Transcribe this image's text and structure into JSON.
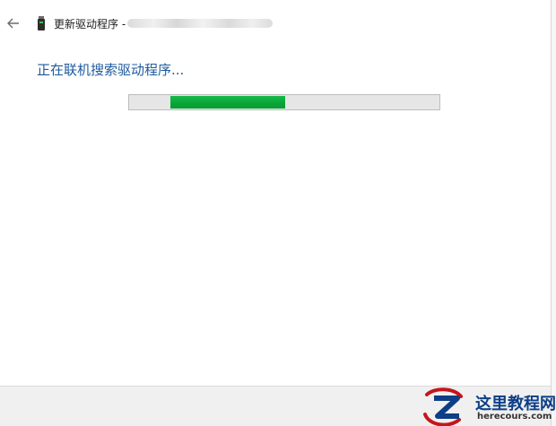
{
  "window": {
    "title": "更新驱动程序 -"
  },
  "main": {
    "status_text": "正在联机搜索驱动程序...",
    "progress": {
      "indeterminate": true,
      "segment_start_fraction": 0.13,
      "segment_end_fraction": 0.5,
      "fill_color": "#0ba839",
      "track_color": "#e6e6e6"
    }
  },
  "icons": {
    "back": "back-arrow-icon",
    "device": "usb-device-icon"
  },
  "watermark": {
    "name": "这里教程网",
    "url": "herecours.com"
  }
}
